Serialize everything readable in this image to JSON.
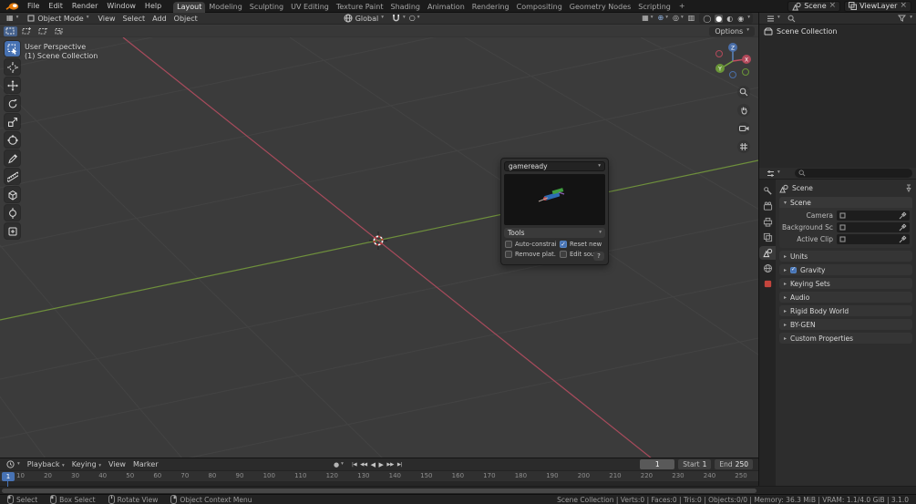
{
  "icons": {
    "dropdown": "▾",
    "collapsed": "▸",
    "expanded": "▾",
    "close": "×",
    "check": "✓",
    "record": "●",
    "visibility": "▦",
    "gizmo": "⊕",
    "overlays": "◎",
    "xray": "▥",
    "proportional": "○",
    "wireframe": "◯",
    "solid": "●",
    "material": "◐",
    "rendered": "◉",
    "viewport_editor": "▦",
    "plus": "+"
  },
  "topbar": {
    "menus": [
      "File",
      "Edit",
      "Render",
      "Window",
      "Help"
    ],
    "workspaces": [
      {
        "label": "Layout",
        "active": true
      },
      {
        "label": "Modeling"
      },
      {
        "label": "Sculpting"
      },
      {
        "label": "UV Editing"
      },
      {
        "label": "Texture Paint"
      },
      {
        "label": "Shading"
      },
      {
        "label": "Animation"
      },
      {
        "label": "Rendering"
      },
      {
        "label": "Compositing"
      },
      {
        "label": "Geometry Nodes"
      },
      {
        "label": "Scripting"
      }
    ],
    "add_workspace": "+",
    "scene": {
      "value": "Scene"
    },
    "view_layer": {
      "value": "ViewLayer"
    }
  },
  "viewport": {
    "mode": "Object Mode",
    "menus": [
      "View",
      "Select",
      "Add",
      "Object"
    ],
    "orientation": "Global",
    "options_label": "Options",
    "view_label": "User Perspective",
    "collection_label": "(1) Scene Collection",
    "gizmo": {
      "x": "X",
      "y": "Y",
      "z": "Z"
    }
  },
  "operator_panel": {
    "preset": "gameready",
    "tools_label": "Tools",
    "options": [
      {
        "label": "Auto-constrain",
        "checked": false
      },
      {
        "label": "Reset new insta...",
        "checked": true
      },
      {
        "label": "Remove plat...",
        "checked": false
      },
      {
        "label": "Edit source",
        "checked": false
      }
    ],
    "help_label": "?"
  },
  "outliner": {
    "root_label": "Scene Collection"
  },
  "properties": {
    "breadcrumb": "Scene",
    "section_title": "Scene",
    "fields": [
      {
        "label": "Camera"
      },
      {
        "label": "Background Scene"
      },
      {
        "label": "Active Clip"
      }
    ],
    "sections": [
      {
        "label": "Units"
      },
      {
        "label": "Gravity",
        "has_checkbox": true,
        "checked": true
      },
      {
        "label": "Keying Sets"
      },
      {
        "label": "Audio"
      },
      {
        "label": "Rigid Body World"
      },
      {
        "label": "BY-GEN"
      },
      {
        "label": "Custom Properties"
      }
    ]
  },
  "timeline": {
    "menus": [
      "Playback",
      "Keying",
      "View",
      "Marker"
    ],
    "controls": [
      {
        "glyph": "|◀"
      },
      {
        "glyph": "◀◀"
      },
      {
        "glyph": "◀"
      },
      {
        "glyph": "▶"
      },
      {
        "glyph": "▶▶"
      },
      {
        "glyph": "▶|"
      }
    ],
    "current_frame": "1",
    "playhead": "1",
    "start_label": "Start",
    "start_value": "1",
    "end_label": "End",
    "end_value": "250",
    "ticks": [
      "10",
      "20",
      "30",
      "40",
      "50",
      "60",
      "70",
      "80",
      "90",
      "100",
      "110",
      "120",
      "130",
      "140",
      "150",
      "160",
      "170",
      "180",
      "190",
      "200",
      "210",
      "220",
      "230",
      "240",
      "250"
    ]
  },
  "statusbar": {
    "hints": [
      {
        "label": "Select"
      },
      {
        "label": "Box Select"
      },
      {
        "label": "Rotate View"
      },
      {
        "label": "Object Context Menu"
      }
    ],
    "stats": "Scene Collection  |  Verts:0  |  Faces:0  |  Tris:0  |  Objects:0/0  |  Memory: 36.3 MiB  |  VRAM: 1.1/4.0 GiB  |  3.1.0"
  }
}
